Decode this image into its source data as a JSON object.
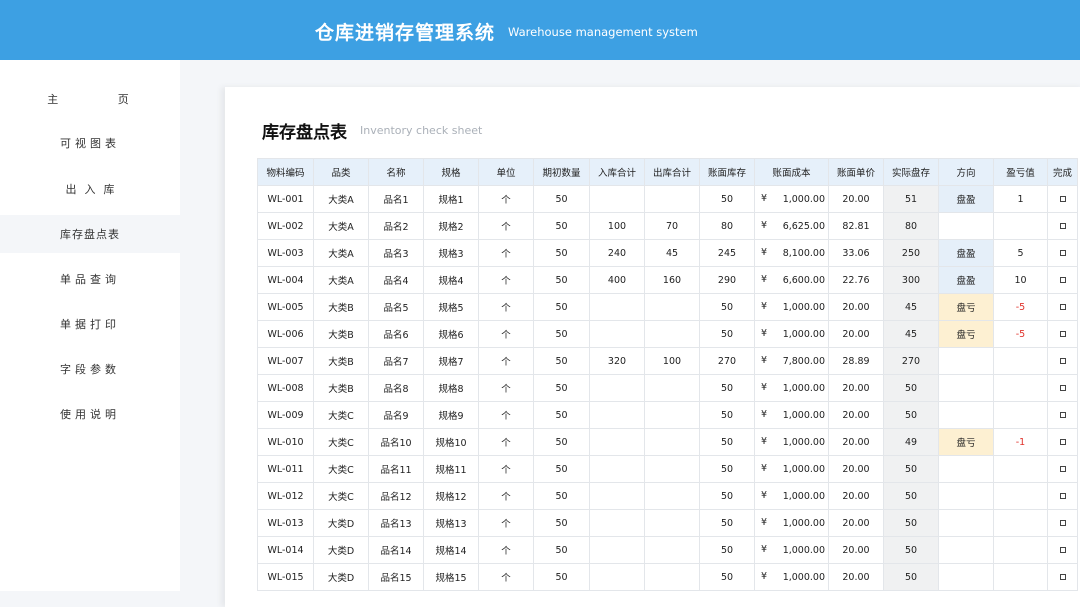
{
  "header": {
    "title": "仓库进销存管理系统",
    "subtitle": "Warehouse management system"
  },
  "sidebar": {
    "items": [
      {
        "label": "主 页"
      },
      {
        "label": "可视图表"
      },
      {
        "label": "出入库"
      },
      {
        "label": "库存盘点表"
      },
      {
        "label": "单品查询"
      },
      {
        "label": "单据打印"
      },
      {
        "label": "字段参数"
      },
      {
        "label": "使用说明"
      }
    ],
    "active_index": 3
  },
  "sheet": {
    "title": "库存盘点表",
    "subtitle": "Inventory check sheet",
    "columns": [
      "物料编码",
      "品类",
      "名称",
      "规格",
      "单位",
      "期初数量",
      "入库合计",
      "出库合计",
      "账面库存",
      "账面成本",
      "账面单价",
      "实际盘存",
      "方向",
      "盈亏值",
      "完成"
    ],
    "currency_symbol": "¥",
    "rows": [
      {
        "code": "WL-001",
        "cat": "大类A",
        "name": "品名1",
        "spec": "规格1",
        "unit": "个",
        "open": "50",
        "in": "",
        "out": "",
        "book": "50",
        "cost": "1,000.00",
        "price": "20.00",
        "actual": "51",
        "dir": "盘盈",
        "diff": "1"
      },
      {
        "code": "WL-002",
        "cat": "大类A",
        "name": "品名2",
        "spec": "规格2",
        "unit": "个",
        "open": "50",
        "in": "100",
        "out": "70",
        "book": "80",
        "cost": "6,625.00",
        "price": "82.81",
        "actual": "80",
        "dir": "",
        "diff": ""
      },
      {
        "code": "WL-003",
        "cat": "大类A",
        "name": "品名3",
        "spec": "规格3",
        "unit": "个",
        "open": "50",
        "in": "240",
        "out": "45",
        "book": "245",
        "cost": "8,100.00",
        "price": "33.06",
        "actual": "250",
        "dir": "盘盈",
        "diff": "5"
      },
      {
        "code": "WL-004",
        "cat": "大类A",
        "name": "品名4",
        "spec": "规格4",
        "unit": "个",
        "open": "50",
        "in": "400",
        "out": "160",
        "book": "290",
        "cost": "6,600.00",
        "price": "22.76",
        "actual": "300",
        "dir": "盘盈",
        "diff": "10"
      },
      {
        "code": "WL-005",
        "cat": "大类B",
        "name": "品名5",
        "spec": "规格5",
        "unit": "个",
        "open": "50",
        "in": "",
        "out": "",
        "book": "50",
        "cost": "1,000.00",
        "price": "20.00",
        "actual": "45",
        "dir": "盘亏",
        "diff": "-5"
      },
      {
        "code": "WL-006",
        "cat": "大类B",
        "name": "品名6",
        "spec": "规格6",
        "unit": "个",
        "open": "50",
        "in": "",
        "out": "",
        "book": "50",
        "cost": "1,000.00",
        "price": "20.00",
        "actual": "45",
        "dir": "盘亏",
        "diff": "-5"
      },
      {
        "code": "WL-007",
        "cat": "大类B",
        "name": "品名7",
        "spec": "规格7",
        "unit": "个",
        "open": "50",
        "in": "320",
        "out": "100",
        "book": "270",
        "cost": "7,800.00",
        "price": "28.89",
        "actual": "270",
        "dir": "",
        "diff": ""
      },
      {
        "code": "WL-008",
        "cat": "大类B",
        "name": "品名8",
        "spec": "规格8",
        "unit": "个",
        "open": "50",
        "in": "",
        "out": "",
        "book": "50",
        "cost": "1,000.00",
        "price": "20.00",
        "actual": "50",
        "dir": "",
        "diff": ""
      },
      {
        "code": "WL-009",
        "cat": "大类C",
        "name": "品名9",
        "spec": "规格9",
        "unit": "个",
        "open": "50",
        "in": "",
        "out": "",
        "book": "50",
        "cost": "1,000.00",
        "price": "20.00",
        "actual": "50",
        "dir": "",
        "diff": ""
      },
      {
        "code": "WL-010",
        "cat": "大类C",
        "name": "品名10",
        "spec": "规格10",
        "unit": "个",
        "open": "50",
        "in": "",
        "out": "",
        "book": "50",
        "cost": "1,000.00",
        "price": "20.00",
        "actual": "49",
        "dir": "盘亏",
        "diff": "-1"
      },
      {
        "code": "WL-011",
        "cat": "大类C",
        "name": "品名11",
        "spec": "规格11",
        "unit": "个",
        "open": "50",
        "in": "",
        "out": "",
        "book": "50",
        "cost": "1,000.00",
        "price": "20.00",
        "actual": "50",
        "dir": "",
        "diff": ""
      },
      {
        "code": "WL-012",
        "cat": "大类C",
        "name": "品名12",
        "spec": "规格12",
        "unit": "个",
        "open": "50",
        "in": "",
        "out": "",
        "book": "50",
        "cost": "1,000.00",
        "price": "20.00",
        "actual": "50",
        "dir": "",
        "diff": ""
      },
      {
        "code": "WL-013",
        "cat": "大类D",
        "name": "品名13",
        "spec": "规格13",
        "unit": "个",
        "open": "50",
        "in": "",
        "out": "",
        "book": "50",
        "cost": "1,000.00",
        "price": "20.00",
        "actual": "50",
        "dir": "",
        "diff": ""
      },
      {
        "code": "WL-014",
        "cat": "大类D",
        "name": "品名14",
        "spec": "规格14",
        "unit": "个",
        "open": "50",
        "in": "",
        "out": "",
        "book": "50",
        "cost": "1,000.00",
        "price": "20.00",
        "actual": "50",
        "dir": "",
        "diff": ""
      },
      {
        "code": "WL-015",
        "cat": "大类D",
        "name": "品名15",
        "spec": "规格15",
        "unit": "个",
        "open": "50",
        "in": "",
        "out": "",
        "book": "50",
        "cost": "1,000.00",
        "price": "20.00",
        "actual": "50",
        "dir": "",
        "diff": ""
      }
    ]
  },
  "colors": {
    "header": "#3da0e3",
    "gain_bg": "#e5eff9",
    "loss_bg": "#fdf0d2",
    "negative_text": "#e0322b"
  }
}
